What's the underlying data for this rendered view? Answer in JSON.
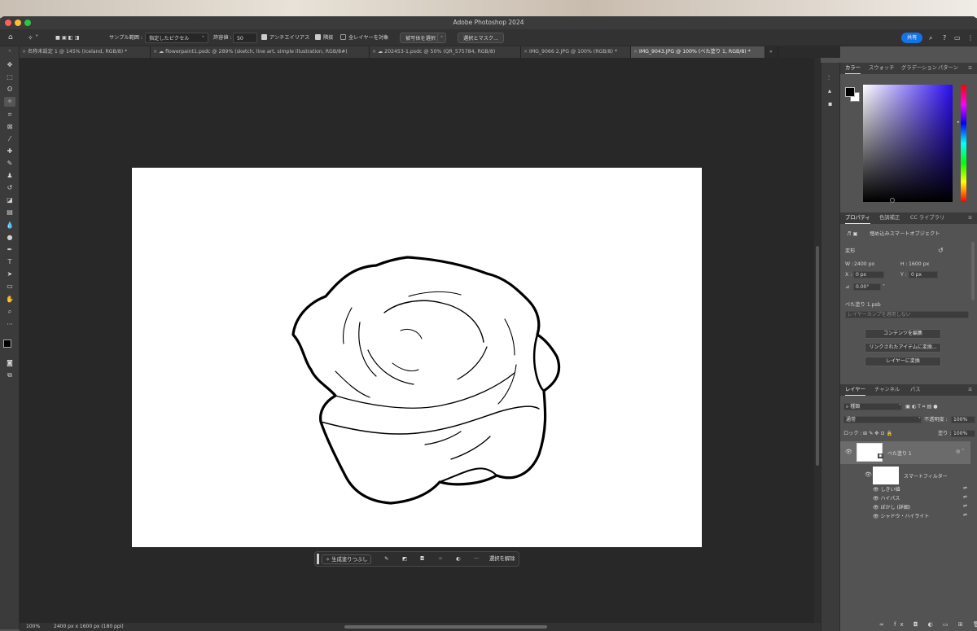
{
  "app": {
    "title": "Adobe Photoshop 2024"
  },
  "options_bar": {
    "sample_label": "サンプル範囲 :",
    "sample_value": "指定したピクセル",
    "tolerance_label": "許容値 :",
    "tolerance_value": "50",
    "antialias": "アンチエイリアス",
    "contiguous": "隣接",
    "all_layers": "全レイヤーを対象",
    "select_subject": "被写体を選択",
    "select_mask": "選択とマスク...",
    "share": "共有"
  },
  "tabs": [
    {
      "label": "名称未設定 1 @ 145% (Iceland, RGB/8) *"
    },
    {
      "label": "flowerpaint1.psdc @ 289% (sketch, line art, simple illustration, RGB/8#)"
    },
    {
      "label": "202453-1.psdc @ 50% (QR_575784, RGB/8)"
    },
    {
      "label": "IMG_9066 2.JPG @ 100% (RGB/8) *"
    },
    {
      "label": "IMG_9043.JPG @ 100% (べた塗り 1, RGB/8) *"
    }
  ],
  "context_bar": {
    "generative_fill": "生成塗りつぶし",
    "deselect": "選択を解除"
  },
  "status": {
    "zoom": "100%",
    "doc_info": "2400 px x 1600 px (180 ppi)"
  },
  "color_panel": {
    "tabs": [
      "カラー",
      "スウォッチ",
      "グラデーション",
      "パターン"
    ],
    "hue_color": "#2b0cf2"
  },
  "properties": {
    "tabs": [
      "プロパティ",
      "色調補正",
      "CC ライブラリ"
    ],
    "type": "埋め込みスマートオブジェクト",
    "transform_label": "変形",
    "w_label": "W :",
    "w_value": "2400 px",
    "h_label": "H :",
    "h_value": "1600 px",
    "x_label": "X :",
    "x_value": "0 px",
    "y_label": "Y :",
    "y_value": "0 px",
    "angle": "0.00°",
    "file": "べた塗り 1.psb",
    "comp_placeholder": "レイヤーカンプを適用しない",
    "edit_contents": "コンテンツを編集",
    "relink": "リンクされたアイテムに変換...",
    "convert_to_layer": "レイヤーに変換"
  },
  "layers": {
    "tabs": [
      "レイヤー",
      "チャンネル",
      "パス"
    ],
    "filter": "種類",
    "blend": "通常",
    "opacity_label": "不透明度 :",
    "opacity": "100%",
    "lock_label": "ロック :",
    "fill_label": "塗り :",
    "fill": "100%",
    "layer_name": "べた塗り 1",
    "smart_filters": "スマートフィルター",
    "filters": [
      "しきい値",
      "ハイパス",
      "ぼかし (詳細)",
      "シャドウ・ハイライト"
    ]
  }
}
